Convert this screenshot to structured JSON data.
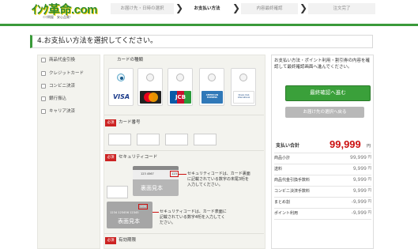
{
  "header": {
    "logo_text": "ｲﾝｸ革命.com",
    "logo_sub": "ｲﾝｸ問屋　安心品質！",
    "steps": [
      "お届け先・日時の選択",
      "お支払い方法",
      "内容最終確認",
      "注文完了"
    ]
  },
  "page_title": "4.お支払い方法を選択してください。",
  "payment_methods": [
    {
      "label": "商品代金引換",
      "checked": false
    },
    {
      "label": "クレジットカード",
      "checked": false
    },
    {
      "label": "コンビニ決済",
      "checked": false
    },
    {
      "label": "銀行振込",
      "checked": false
    },
    {
      "label": "キャリア決済",
      "checked": false
    }
  ],
  "card_form": {
    "card_type_label": "カードの種類",
    "cards": [
      {
        "name": "VISA",
        "selected": true,
        "color": "#1a3a8a"
      },
      {
        "name": "MasterCard",
        "selected": false,
        "color": "#e8a000"
      },
      {
        "name": "JCB",
        "selected": false,
        "color": "#0a5aa8"
      },
      {
        "name": "AMERICAN EXPRESS",
        "selected": false,
        "color": "#2f78b8"
      },
      {
        "name": "Diners Club International",
        "selected": false,
        "color": "#0b3c7a"
      }
    ],
    "required_label": "必須",
    "card_number_label": "カード番号",
    "security_code_label": "セキュリティコード",
    "card_sample_1": {
      "number": "123 4567",
      "caption": "裏面見本",
      "code": "123"
    },
    "card_sample_2": {
      "number": "1234 123456 12345",
      "caption": "表面見本",
      "code": "1234"
    },
    "note_1": "セキュリティコードは、カード裏面に記載されている数字の末尾3桁を入力してください。",
    "note_2": "セキュリティコードは、カード表面に記載されている数字4桁を入力してください。",
    "expiry_label": "有効期限"
  },
  "summary": {
    "note": "お支払い方法・ポイント利用・割引券の内容を確認して最終確認画面へ進んでください。",
    "confirm_button": "最終確認へ進む",
    "back_button": "お届け先の選択へ戻る",
    "total_label": "支払い合計",
    "total_value": "99,999",
    "currency": "円",
    "rows": [
      {
        "label": "商品小計",
        "value": "99,999"
      },
      {
        "label": "送料",
        "value": "9,999"
      },
      {
        "label": "商品代金引換手数料",
        "value": "9,999"
      },
      {
        "label": "コンビニ決済手数料",
        "value": "9,999"
      },
      {
        "label": "まとめ割",
        "value": "-9,999"
      },
      {
        "label": "ポイント利用",
        "value": "-9,999"
      }
    ]
  },
  "colors": {
    "brand_green": "#3a9a3a",
    "price_red": "#cc1111",
    "required_red": "#cc2222"
  }
}
